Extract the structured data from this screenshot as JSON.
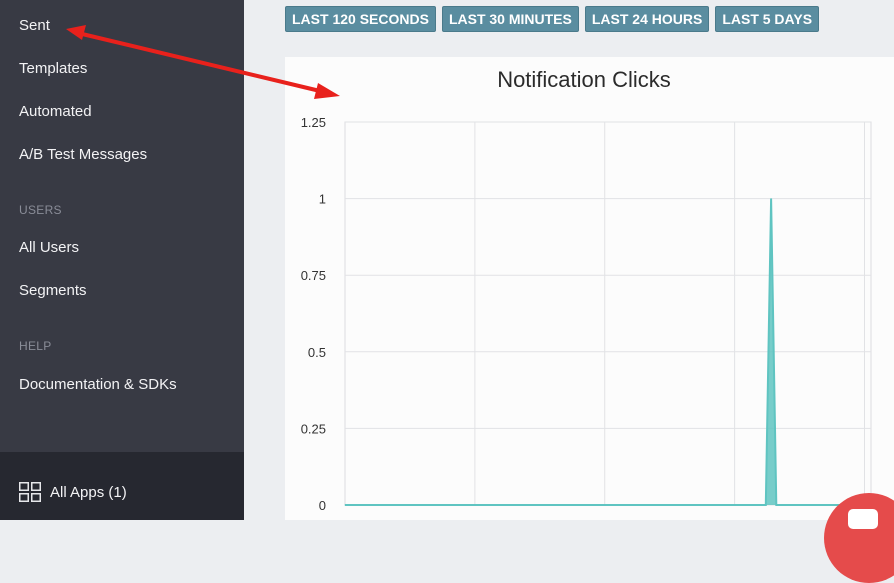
{
  "sidebar": {
    "items_top": [
      {
        "label": "Sent"
      },
      {
        "label": "Templates"
      },
      {
        "label": "Automated"
      },
      {
        "label": "A/B Test Messages"
      }
    ],
    "users_section": "USERS",
    "users_items": [
      {
        "label": "All Users"
      },
      {
        "label": "Segments"
      }
    ],
    "help_section": "HELP",
    "help_items": [
      {
        "label": "Documentation & SDKs"
      }
    ],
    "footer": {
      "label": "All Apps (1)",
      "icon": "grid-icon"
    }
  },
  "range_buttons": [
    {
      "label": "LAST 120 SECONDS"
    },
    {
      "label": "LAST 30 MINUTES"
    },
    {
      "label": "LAST 24 HOURS"
    },
    {
      "label": "LAST 5 DAYS"
    }
  ],
  "colors": {
    "sidebar_bg": "#383a44",
    "button_bg": "#5a8da0",
    "series": "#5fc4c1",
    "annotation_arrow": "#e8211c",
    "chat_bubble": "#e54b4b"
  },
  "chart_data": {
    "type": "area",
    "title": "Notification Clicks",
    "xlabel": "",
    "ylabel": "",
    "ylim": [
      0,
      1.25
    ],
    "y_ticks": [
      "1.25",
      "1",
      "0.75",
      "0.5",
      "0.25",
      "0"
    ],
    "x_grid_lines": 4,
    "grid": true,
    "series": [
      {
        "x": [
          0,
          0.8,
          0.81,
          0.82,
          1
        ],
        "values": [
          0,
          0,
          1,
          0,
          0
        ]
      }
    ]
  }
}
